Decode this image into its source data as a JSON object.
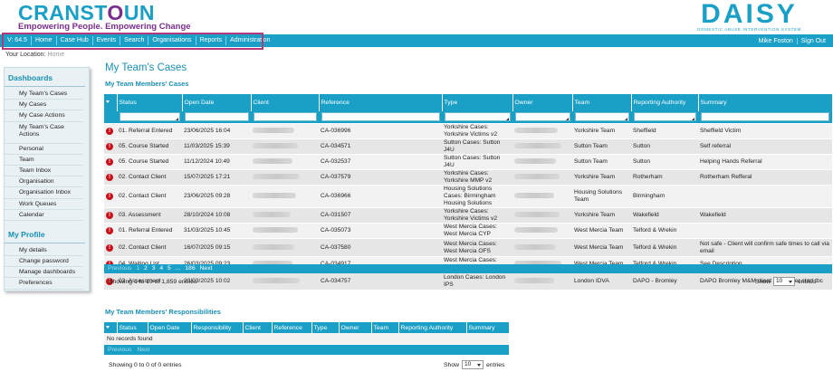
{
  "brand": {
    "logo_a": "CRANST",
    "logo_b": "O",
    "logo_c": "UN",
    "tagline": "Empowering People. Empowering Change",
    "daisy": "DAISY",
    "daisy_sub": "DOMESTIC ABUSE INTERVENTION SYSTEM"
  },
  "nav": {
    "items": [
      "V: 64.5",
      "Home",
      "Case Hub",
      "Events",
      "Search",
      "Organisations",
      "Reports",
      "Administration"
    ],
    "user": "Mike Foston",
    "signout": "Sign Out"
  },
  "location": {
    "label": "Your Location:",
    "value": "Home"
  },
  "sidebar": {
    "dashboards_title": "Dashboards",
    "dashboards": [
      "My Team's Cases",
      "My Cases",
      "My Case Actions",
      "My Team's Case Actions",
      "Personal",
      "Team",
      "Team Inbox",
      "Organisation",
      "Organisation Inbox",
      "Work Queues",
      "Calendar"
    ],
    "profile_title": "My Profile",
    "profile": [
      "My details",
      "Change password",
      "Manage dashboards",
      "Preferences"
    ]
  },
  "main": {
    "title": "My Team's Cases",
    "section1": "My Team Members' Cases",
    "columns": [
      "Status",
      "Open Date",
      "Client",
      "Reference",
      "Type",
      "Owner",
      "Team",
      "Reporting Authority",
      "Summary"
    ],
    "rows": [
      {
        "status": "01. Referral Entered",
        "date": "23/06/2025 16:04",
        "ref": "CA-036996",
        "type": "Yorkshire Cases: Yorkshire Victims v2",
        "team": "Yorkshire Team",
        "auth": "Sheffield",
        "summary": "Sheffield Victim"
      },
      {
        "status": "05. Course Started",
        "date": "11/03/2025 15:39",
        "ref": "CA-034571",
        "type": "Sutton Cases: Sutton J4U",
        "team": "Sutton Team",
        "auth": "Sutton",
        "summary": "Self referral"
      },
      {
        "status": "05. Course Started",
        "date": "11/12/2024 10:49",
        "ref": "CA-032537",
        "type": "Sutton Cases: Sutton J4U",
        "team": "Sutton Team",
        "auth": "Sutton",
        "summary": "Helping Hands Referral"
      },
      {
        "status": "02. Contact Client",
        "date": "15/07/2025 17:21",
        "ref": "CA-037579",
        "type": "Yorkshire Cases: Yorkshire MMP v2",
        "team": "Yorkshire Team",
        "auth": "Rotherham",
        "summary": "Rotherham Refferal"
      },
      {
        "status": "02. Contact Client",
        "date": "23/06/2025 09:28",
        "ref": "CA-036966",
        "type": "Housing Solutions Cases: Birmingham Housing Solutions",
        "team": "Housing Solutions Team",
        "auth": "Birmingham",
        "summary": ""
      },
      {
        "status": "03. Assessment",
        "date": "28/10/2024 10:08",
        "ref": "CA-031507",
        "type": "Yorkshire Cases: Yorkshire Victims v2",
        "team": "Yorkshire Team",
        "auth": "Wakefield",
        "summary": "Wakefield"
      },
      {
        "status": "01. Referral Entered",
        "date": "31/03/2025 10:45",
        "ref": "CA-035073",
        "type": "West Mercia Cases: West Mercia CYP",
        "team": "West Mercia Team",
        "auth": "Telford & Wrekin",
        "summary": ""
      },
      {
        "status": "02. Contact Client",
        "date": "16/07/2025 09:15",
        "ref": "CA-037580",
        "type": "West Mercia Cases: West Mercia OFS",
        "team": "West Mercia Team",
        "auth": "Telford & Wrekin",
        "summary": "Not safe - Client will confirm safe times to call via email"
      },
      {
        "status": "04. Waiting List",
        "date": "26/03/2025 09:23",
        "ref": "CA-034917",
        "type": "West Mercia Cases: West Mercia CYP",
        "team": "West Mercia Team",
        "auth": "Telford & Wrekin",
        "summary": "See Description"
      },
      {
        "status": "03. Assessment",
        "date": "20/03/2025 10:02",
        "ref": "CA-034757",
        "type": "London Cases: London IPS",
        "team": "London IDVA",
        "auth": "DAPO - Bromley",
        "summary": "DAPO Bromley M&M client ex partner start tbc"
      }
    ],
    "pager": {
      "prev": "Previous",
      "pages": [
        "1",
        "2",
        "3",
        "4",
        "5",
        "...",
        "186"
      ],
      "next": "Next"
    },
    "showing": "Showing 1 to 10 of 1,859 entries",
    "show_label": "Show",
    "show_value": "10",
    "entries_label": "entries",
    "section2": "My Team Members' Responsibilities",
    "columns2": [
      "Status",
      "Open Date",
      "Responsibility",
      "Client",
      "Reference",
      "Type",
      "Owner",
      "Team",
      "Reporting Authority",
      "Summary"
    ],
    "no_records": "No records found",
    "pager2": {
      "prev": "Previous",
      "next": "Next"
    },
    "showing2": "Showing 0 to 0 of 0 entries"
  },
  "colors": {
    "accent": "#1aa0c6",
    "brand_purple": "#7b2d8e",
    "alert": "#c8101a"
  }
}
